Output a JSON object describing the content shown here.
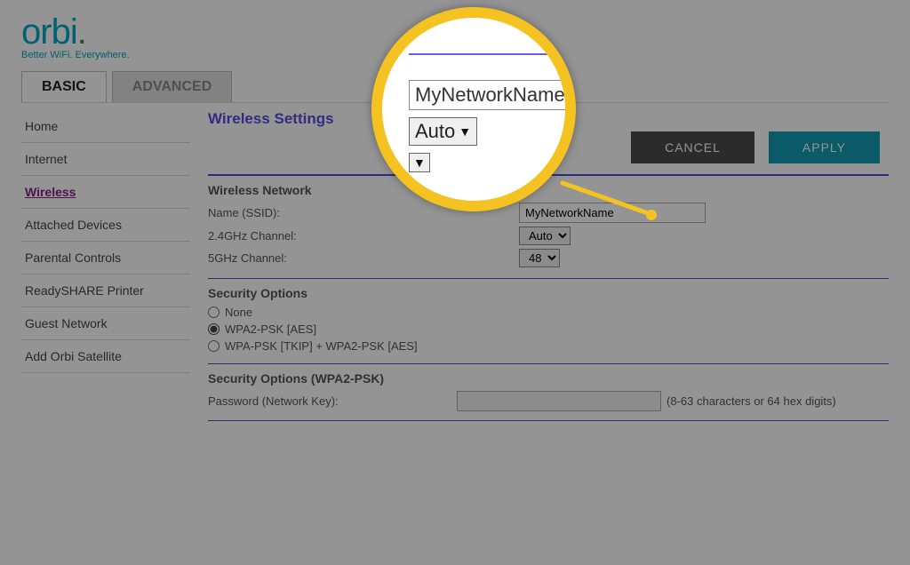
{
  "brand": {
    "name": "orbi",
    "tagline": "Better WiFi. Everywhere."
  },
  "tabs": {
    "basic": "BASIC",
    "advanced": "ADVANCED"
  },
  "sidebar": {
    "items": [
      {
        "label": "Home"
      },
      {
        "label": "Internet"
      },
      {
        "label": "Wireless"
      },
      {
        "label": "Attached Devices"
      },
      {
        "label": "Parental Controls"
      },
      {
        "label": "ReadySHARE Printer"
      },
      {
        "label": "Guest Network"
      },
      {
        "label": "Add Orbi Satellite"
      }
    ]
  },
  "content": {
    "page_title": "Wireless Settings",
    "cancel_label": "CANCEL",
    "apply_label": "APPLY",
    "wireless_network": {
      "section_title": "Wireless Network",
      "ssid_label": "Name (SSID):",
      "ssid_value": "MyNetworkName",
      "ch24_label": "2.4GHz Channel:",
      "ch24_value": "Auto",
      "ch5_label": "5GHz Channel:",
      "ch5_value": "48"
    },
    "security_options": {
      "section_title": "Security Options",
      "opt_none": "None",
      "opt_wpa2": "WPA2-PSK [AES]",
      "opt_mixed": "WPA-PSK [TKIP] + WPA2-PSK [AES]"
    },
    "security_wpa2": {
      "section_title": "Security Options (WPA2-PSK)",
      "password_label": "Password (Network Key):",
      "password_value": "",
      "hint": "(8-63 characters or 64 hex digits)"
    }
  },
  "callout": {
    "ssid_value": "MyNetworkName",
    "auto_value": "Auto"
  }
}
